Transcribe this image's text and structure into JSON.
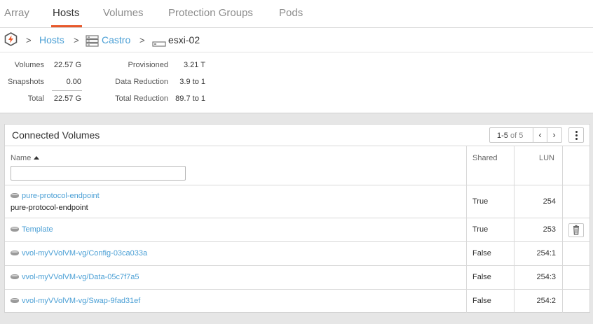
{
  "nav": {
    "tabs": [
      "Array",
      "Hosts",
      "Volumes",
      "Protection Groups",
      "Pods"
    ],
    "active": "Hosts"
  },
  "breadcrumb": {
    "sep": ">",
    "hosts": "Hosts",
    "group": "Castro",
    "current": "esxi-02"
  },
  "stats": {
    "volumes_label": "Volumes",
    "volumes_value": "22.57 G",
    "snapshots_label": "Snapshots",
    "snapshots_value": "0.00",
    "total_label": "Total",
    "total_value": "22.57 G",
    "provisioned_label": "Provisioned",
    "provisioned_value": "3.21 T",
    "data_reduction_label": "Data Reduction",
    "data_reduction_value": "3.9 to 1",
    "total_reduction_label": "Total Reduction",
    "total_reduction_value": "89.7 to 1"
  },
  "panel": {
    "title": "Connected Volumes",
    "pager_range": "1-5",
    "pager_of": "of 5",
    "prev": "‹",
    "next": "›",
    "columns": {
      "name": "Name",
      "shared": "Shared",
      "lun": "LUN"
    },
    "filter_placeholder": "",
    "rows": [
      {
        "name": "pure-protocol-endpoint",
        "subtitle": "pure-protocol-endpoint",
        "shared": "True",
        "lun": "254"
      },
      {
        "name": "Template",
        "subtitle": "",
        "shared": "True",
        "lun": "253"
      },
      {
        "name": "vvol-myVVolVM-vg/Config-03ca033a",
        "subtitle": "",
        "shared": "False",
        "lun": "254:1"
      },
      {
        "name": "vvol-myVVolVM-vg/Data-05c7f7a5",
        "subtitle": "",
        "shared": "False",
        "lun": "254:3"
      },
      {
        "name": "vvol-myVVolVM-vg/Swap-9fad31ef",
        "subtitle": "",
        "shared": "False",
        "lun": "254:2"
      }
    ]
  },
  "colors": {
    "accent": "#e8582a",
    "link": "#4a9fd5"
  }
}
